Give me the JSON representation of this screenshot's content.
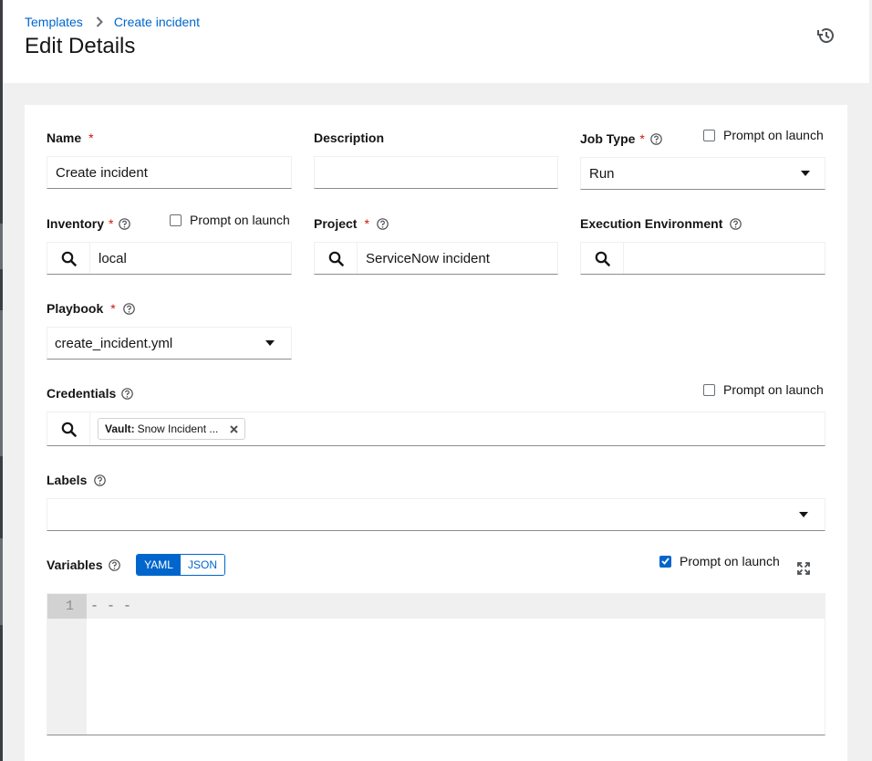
{
  "breadcrumb": {
    "items": [
      "Templates",
      "Create incident"
    ]
  },
  "page": {
    "title": "Edit Details"
  },
  "form": {
    "name": {
      "label": "Name",
      "required": "*",
      "value": "Create incident"
    },
    "description": {
      "label": "Description",
      "value": ""
    },
    "job_type": {
      "label": "Job Type",
      "required": "*",
      "value": "Run",
      "prompt": "Prompt on launch"
    },
    "inventory": {
      "label": "Inventory",
      "required": "*",
      "value": "local",
      "prompt": "Prompt on launch"
    },
    "project": {
      "label": "Project",
      "required": "*",
      "value": "ServiceNow incident"
    },
    "execution_environment": {
      "label": "Execution Environment",
      "value": ""
    },
    "playbook": {
      "label": "Playbook",
      "required": "*",
      "value": "create_incident.yml"
    },
    "credentials": {
      "label": "Credentials",
      "prompt": "Prompt on launch",
      "chip_type": "Vault:",
      "chip_label": "Snow Incident ..."
    },
    "labels": {
      "label": "Labels",
      "value": ""
    },
    "variables": {
      "label": "Variables",
      "yaml": "YAML",
      "json": "JSON",
      "mode": "YAML",
      "prompt": "Prompt on launch",
      "prompt_checked": true,
      "line_number": "1",
      "line1": "- - -"
    }
  },
  "icons": {
    "breadcrumb_separator": "chevron-right-icon",
    "history": "history-icon",
    "help": "question-circle-icon",
    "search": "search-icon",
    "dropdown": "caret-down-icon",
    "remove_chip": "close-icon",
    "expand": "expand-icon"
  },
  "colors": {
    "accent": "#0066cc",
    "required": "#c9190b",
    "page_bg": "#f0f0f0"
  }
}
